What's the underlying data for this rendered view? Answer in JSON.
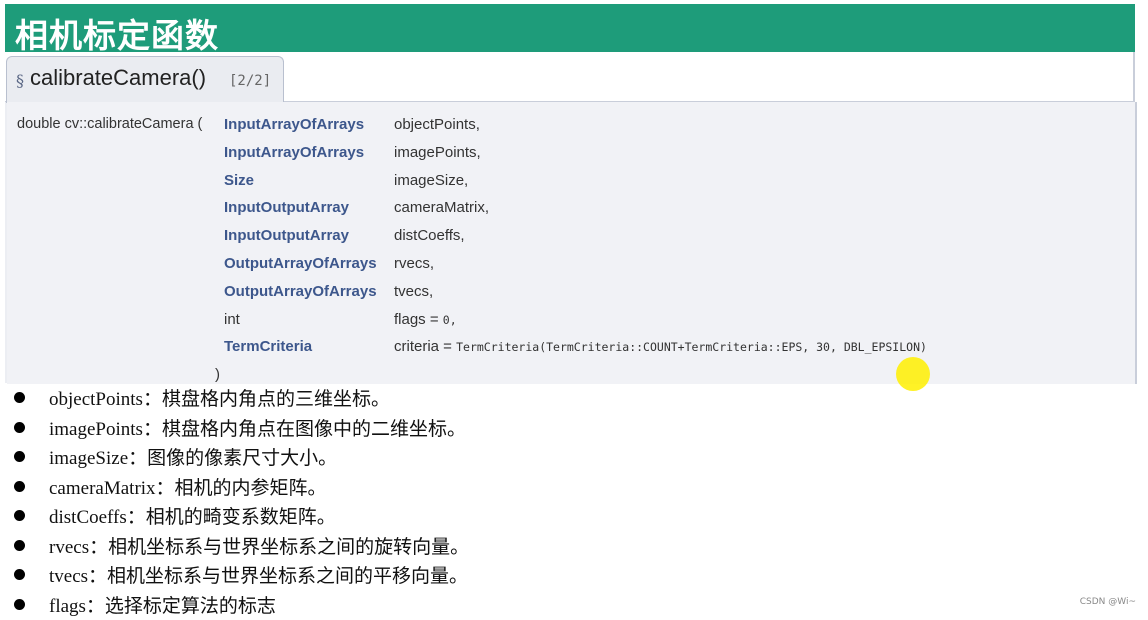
{
  "title": "相机标定函数",
  "function_header": {
    "section_symbol": "§",
    "name": "calibrateCamera()",
    "overload": "[2/2]"
  },
  "declaration": {
    "lead": "double cv::calibrateCamera (",
    "params": [
      {
        "type": "InputArrayOfArrays",
        "name": "objectPoints,",
        "bold": true
      },
      {
        "type": "InputArrayOfArrays",
        "name": "imagePoints,",
        "bold": true
      },
      {
        "type": "Size",
        "name": "imageSize,",
        "bold": true
      },
      {
        "type": "InputOutputArray",
        "name": "cameraMatrix,",
        "bold": true
      },
      {
        "type": "InputOutputArray",
        "name": "distCoeffs,",
        "bold": true
      },
      {
        "type": "OutputArrayOfArrays",
        "name": "rvecs,",
        "bold": true
      },
      {
        "type": "OutputArrayOfArrays",
        "name": "tvecs,",
        "bold": true
      },
      {
        "type": "int",
        "name": "flags = ",
        "default": "0,",
        "bold": false
      },
      {
        "type": "TermCriteria",
        "name": "criteria = ",
        "default": "TermCriteria(TermCriteria::COUNT+TermCriteria::EPS, 30, DBL_EPSILON)",
        "bold": true
      }
    ],
    "close": ")"
  },
  "bullets": [
    "objectPoints：棋盘格内角点的三维坐标。",
    "imagePoints：棋盘格内角点在图像中的二维坐标。",
    "imageSize：图像的像素尺寸大小。",
    "cameraMatrix：相机的内参矩阵。",
    "distCoeffs：相机的畸变系数矩阵。",
    "rvecs：相机坐标系与世界坐标系之间的旋转向量。",
    "tvecs：相机坐标系与世界坐标系之间的平移向量。",
    "flags：选择标定算法的标志"
  ],
  "watermark": "CSDN @Wi~",
  "colors": {
    "title_bar": "#1e9c7a",
    "param_type": "#3d578c"
  }
}
